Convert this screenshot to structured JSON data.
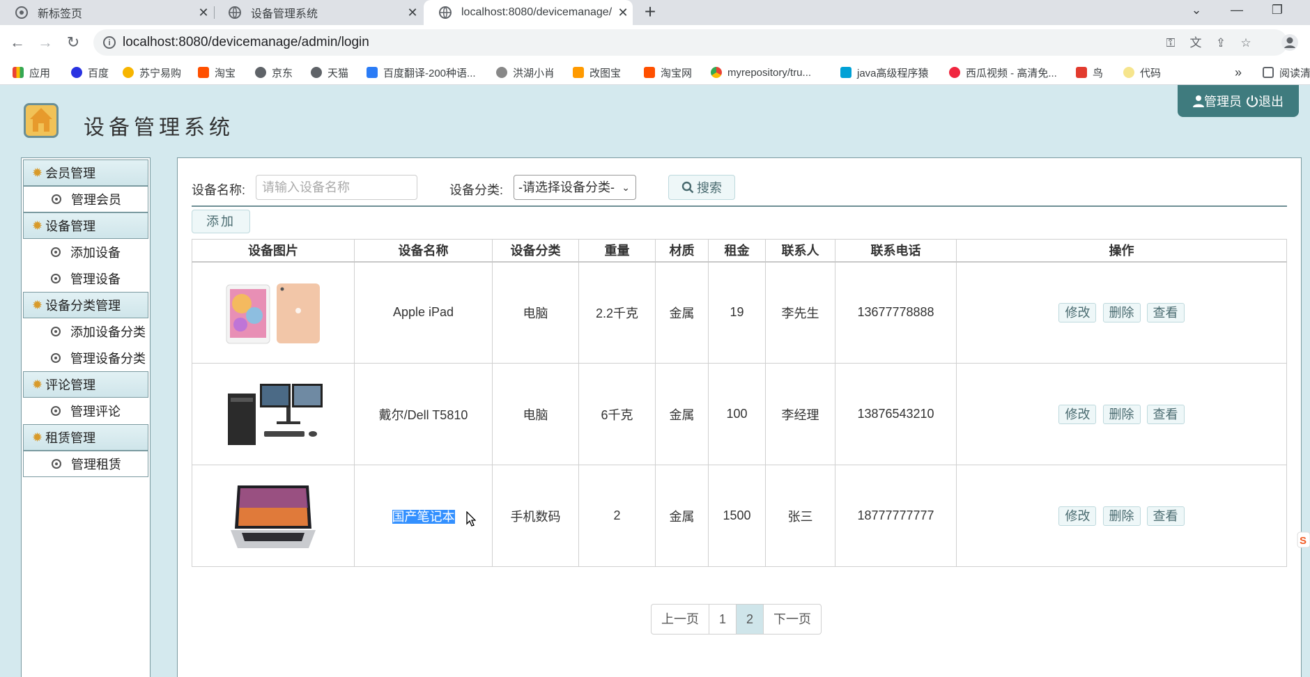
{
  "browser": {
    "tabs": [
      {
        "title": "新标签页"
      },
      {
        "title": "设备管理系统"
      },
      {
        "title": "localhost:8080/devicemanage/"
      }
    ],
    "url": "localhost:8080/devicemanage/admin/login",
    "bookmarks": [
      "应用",
      "百度",
      "苏宁易购",
      "淘宝",
      "京东",
      "天猫",
      "百度翻译-200种语...",
      "洪湖小肖",
      "改图宝",
      "淘宝网",
      "myrepository/tru...",
      "java高级程序猿",
      "西瓜视频 - 高清免...",
      "鸟",
      "代码",
      "阅读清"
    ]
  },
  "header": {
    "title": "设备管理系统",
    "admin_label": "管理员",
    "logout_label": "退出"
  },
  "sidebar": {
    "groups": [
      {
        "label": "会员管理",
        "items": [
          "管理会员"
        ]
      },
      {
        "label": "设备管理",
        "items": [
          "添加设备",
          "管理设备"
        ]
      },
      {
        "label": "设备分类管理",
        "items": [
          "添加设备分类",
          "管理设备分类"
        ]
      },
      {
        "label": "评论管理",
        "items": [
          "管理评论"
        ]
      },
      {
        "label": "租赁管理",
        "items": [
          "管理租赁"
        ]
      }
    ]
  },
  "search": {
    "name_label": "设备名称:",
    "name_placeholder": "请输入设备名称",
    "category_label": "设备分类:",
    "category_selected": "-请选择设备分类-",
    "search_label": "搜索",
    "add_label": "添加"
  },
  "table": {
    "headers": [
      "设备图片",
      "设备名称",
      "设备分类",
      "重量",
      "材质",
      "租金",
      "联系人",
      "联系电话",
      "操作"
    ],
    "rows": [
      {
        "name": "Apple iPad",
        "category": "电脑",
        "weight": "2.2千克",
        "material": "金属",
        "rent": "19",
        "contact": "李先生",
        "phone": "13677778888"
      },
      {
        "name": "戴尔/Dell T5810",
        "category": "电脑",
        "weight": "6千克",
        "material": "金属",
        "rent": "100",
        "contact": "李经理",
        "phone": "13876543210"
      },
      {
        "name": "国产笔记本",
        "category": "手机数码",
        "weight": "2",
        "material": "金属",
        "rent": "1500",
        "contact": "张三",
        "phone": "18777777777"
      }
    ],
    "actions": {
      "edit": "修改",
      "delete": "删除",
      "view": "查看"
    }
  },
  "pager": {
    "prev": "上一页",
    "pages": [
      "1",
      "2"
    ],
    "next": "下一页"
  }
}
